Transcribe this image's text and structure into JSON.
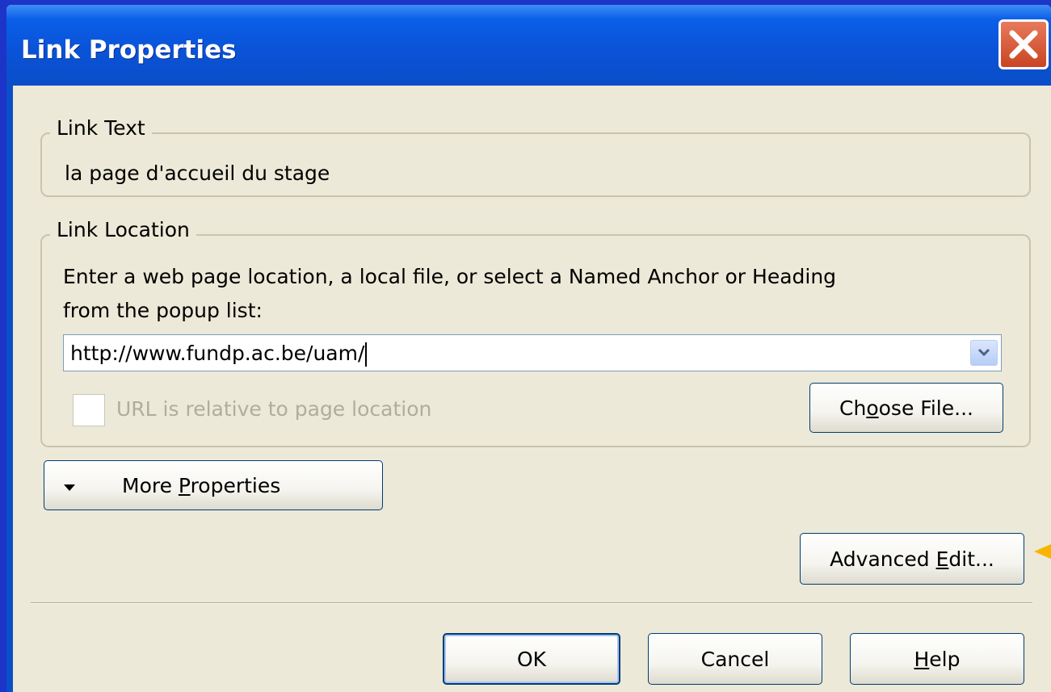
{
  "dialog": {
    "title": "Link Properties"
  },
  "link_text_group": {
    "legend": "Link Text",
    "value": "la page d'accueil du stage"
  },
  "link_location_group": {
    "legend": "Link Location",
    "instructions_line1": "Enter a web page location, a local file, or select a Named Anchor or Heading",
    "instructions_line2": "from the popup list:",
    "url_value": "http://www.fundp.ac.be/uam/",
    "relative_checkbox_label": "URL is relative to page location",
    "relative_checked": false,
    "choose_file": {
      "pre": "Ch",
      "accel": "o",
      "post": "ose File..."
    }
  },
  "more_properties": {
    "pre": "More ",
    "accel": "P",
    "post": "roperties"
  },
  "advanced_edit": {
    "pre": "Advanced ",
    "accel": "E",
    "post": "dit..."
  },
  "buttons": {
    "ok": "OK",
    "cancel": "Cancel",
    "help": {
      "pre": "",
      "accel": "H",
      "post": "elp"
    }
  },
  "colors": {
    "titlebar": "#0a53d8",
    "dialog_bg": "#ece9d8",
    "close_button": "#d0532f",
    "pointer_arrow": "#f7b500"
  }
}
